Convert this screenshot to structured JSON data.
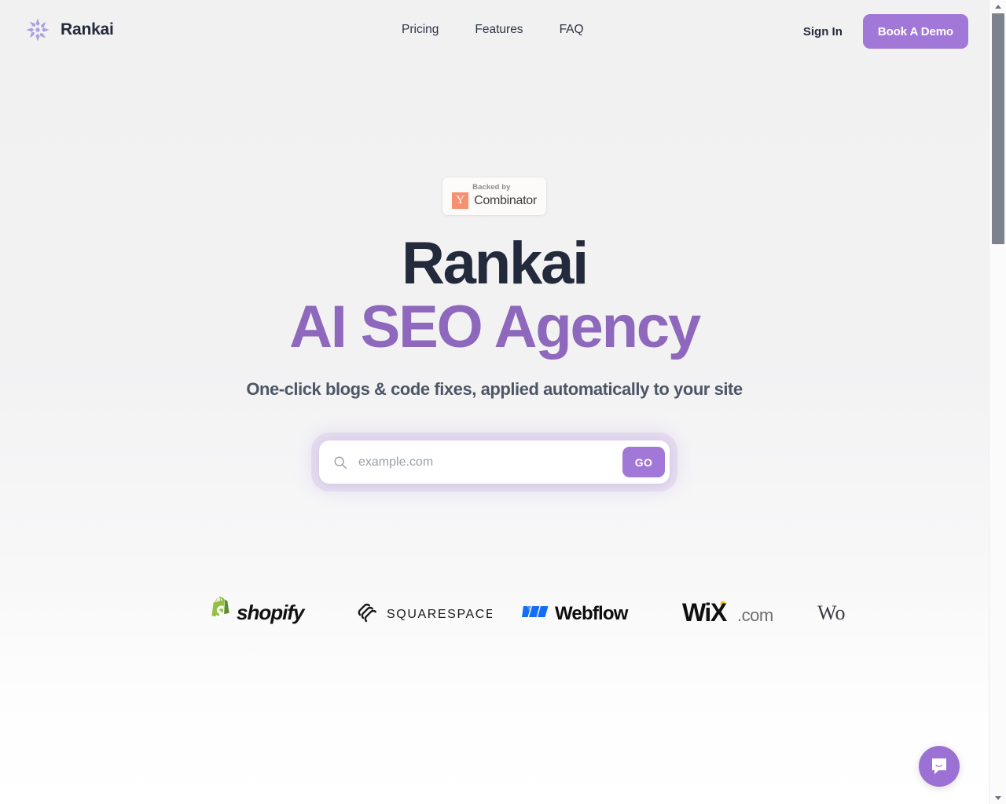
{
  "brand": {
    "name": "Rankai",
    "logo_icon": "starburst-icon",
    "accent_color": "#a177d8",
    "dark_color": "#232a3b"
  },
  "nav": {
    "items": [
      {
        "label": "Pricing"
      },
      {
        "label": "Features"
      },
      {
        "label": "FAQ"
      }
    ],
    "sign_in_label": "Sign In",
    "demo_button_label": "Book A Demo"
  },
  "hero": {
    "badge": {
      "backed_by": "Backed by",
      "y_letter": "Y",
      "combinator": "Combinator",
      "y_color": "#f79070"
    },
    "title_line1": "Rankai",
    "title_line2": "AI SEO Agency",
    "subtitle": "One-click blogs & code fixes, applied automatically to your site"
  },
  "search": {
    "icon": "search-icon",
    "value": "",
    "placeholder": "example.com",
    "submit_label": "GO"
  },
  "logos": {
    "items": [
      {
        "name": "shopify",
        "label": "shopify"
      },
      {
        "name": "squarespace",
        "label": "SQUARESPACE"
      },
      {
        "name": "webflow",
        "label": "Webflow"
      },
      {
        "name": "wix",
        "label": "WiX",
        "suffix": ".com"
      },
      {
        "name": "wordpress",
        "label": "Wo"
      }
    ]
  },
  "chat": {
    "icon": "chat-bubble-icon",
    "color": "#9b72d4"
  },
  "scrollbar": {
    "up_icon": "caret-up-icon",
    "down_icon": "caret-down-icon"
  }
}
